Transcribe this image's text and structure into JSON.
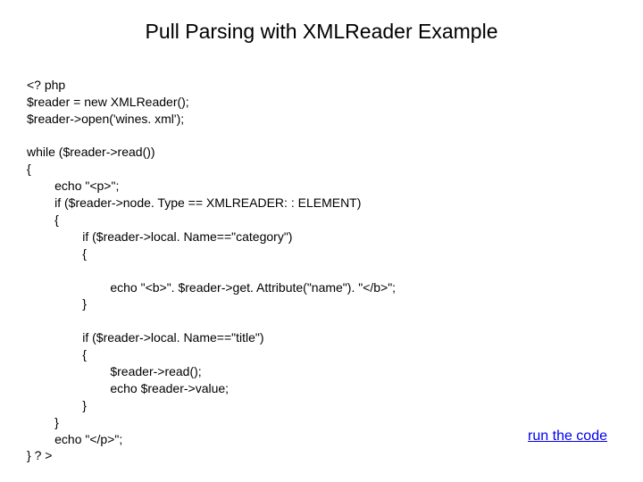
{
  "title": "Pull Parsing with XMLReader Example",
  "code": {
    "l1": "<? php",
    "l2": "$reader = new XMLReader();",
    "l3": "$reader->open('wines. xml');",
    "l4": "",
    "l5": "while ($reader->read())",
    "l6": "{",
    "l7": "        echo \"<p>\";",
    "l8": "        if ($reader->node. Type == XMLREADER: : ELEMENT)",
    "l9": "        {",
    "l10": "                if ($reader->local. Name==\"category\")",
    "l11": "                {",
    "l12": "",
    "l13": "                        echo \"<b>\". $reader->get. Attribute(\"name\"). \"</b>\";",
    "l14": "                }",
    "l15": "",
    "l16": "                if ($reader->local. Name==\"title\")",
    "l17": "                {",
    "l18": "                        $reader->read();",
    "l19": "                        echo $reader->value;",
    "l20": "                }",
    "l21": "        }",
    "l22": "        echo \"</p>\";",
    "l23": "} ? >"
  },
  "link": "run the code"
}
